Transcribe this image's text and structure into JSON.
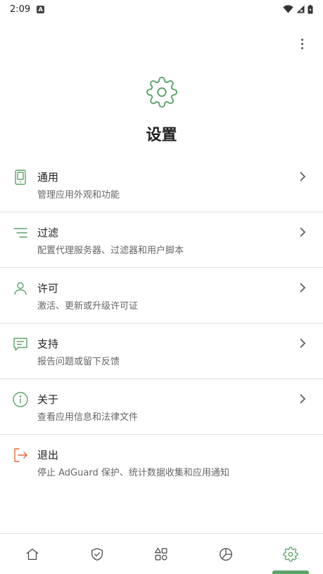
{
  "status_bar": {
    "time": "2:09",
    "app_icon_letter": "A",
    "icons": [
      "wifi-icon",
      "signal-icon",
      "battery-icon"
    ]
  },
  "header": {
    "menu_icon": "more-vert-icon",
    "hero_icon": "gear-icon",
    "title": "设置"
  },
  "colors": {
    "accent": "#5da36c",
    "logout": "#e2683c",
    "text": "#222222",
    "subtext": "#666666"
  },
  "settings": {
    "items": [
      {
        "icon": "phone-icon",
        "title": "通用",
        "subtitle": "管理应用外观和功能",
        "chevron": true
      },
      {
        "icon": "filter-icon",
        "title": "过滤",
        "subtitle": "配置代理服务器、过滤器和用户脚本",
        "chevron": true
      },
      {
        "icon": "person-icon",
        "title": "许可",
        "subtitle": "激活、更新或升级许可证",
        "chevron": true
      },
      {
        "icon": "chat-icon",
        "title": "支持",
        "subtitle": "报告问题或留下反馈",
        "chevron": true
      },
      {
        "icon": "info-icon",
        "title": "关于",
        "subtitle": "查看应用信息和法律文件",
        "chevron": true
      },
      {
        "icon": "logout-icon",
        "title": "退出",
        "subtitle": "停止 AdGuard 保护、统计数据收集和应用通知",
        "chevron": false
      }
    ]
  },
  "bottom_nav": {
    "items": [
      {
        "icon": "home-icon",
        "active": false
      },
      {
        "icon": "shield-icon",
        "active": false
      },
      {
        "icon": "apps-icon",
        "active": false
      },
      {
        "icon": "pie-chart-icon",
        "active": false
      },
      {
        "icon": "gear-icon",
        "active": true
      }
    ]
  }
}
